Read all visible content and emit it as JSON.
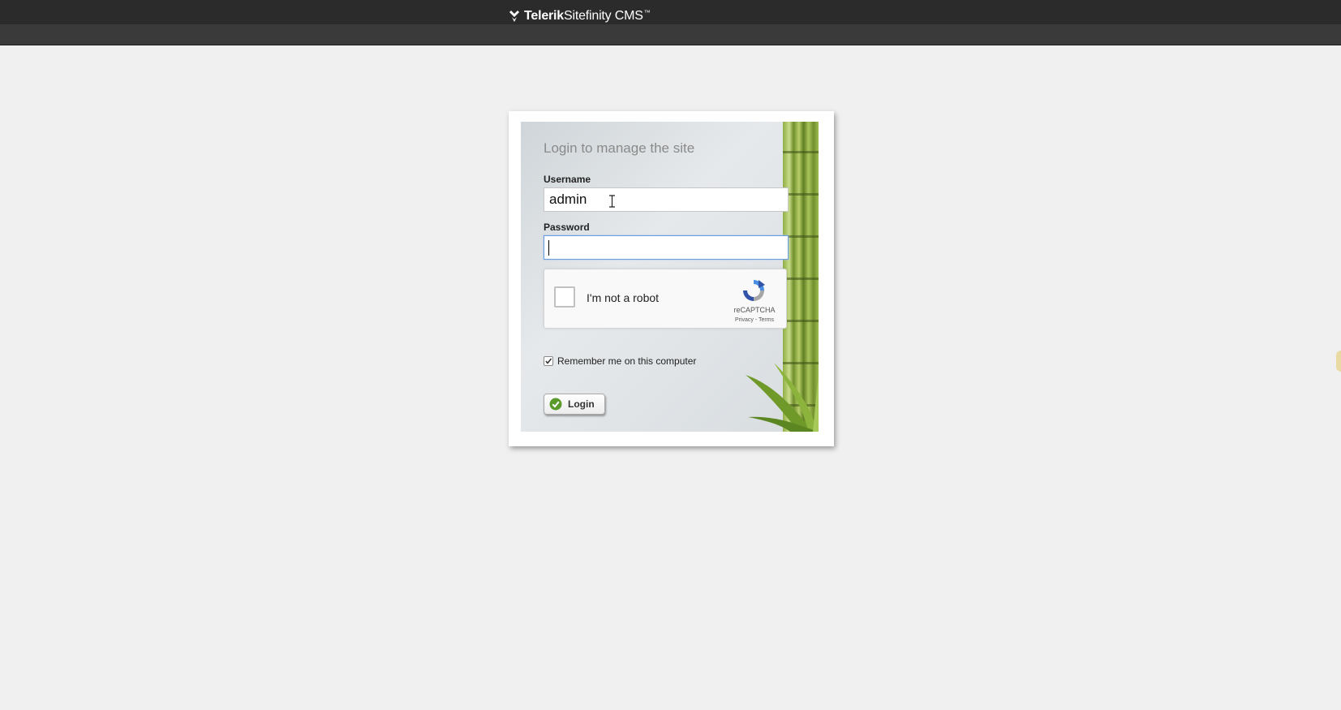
{
  "header": {
    "brand_bold": "Telerik",
    "brand_light": "Sitefinity CMS",
    "brand_tm": "™",
    "logo_icon": "telerik-logo-icon"
  },
  "login": {
    "title": "Login to manage the site",
    "username_label": "Username",
    "username_value": "admin",
    "password_label": "Password",
    "password_value": "",
    "remember_label": "Remember me on this computer",
    "remember_checked": true,
    "login_button_label": "Login",
    "login_icon": "check-circle-icon"
  },
  "captcha": {
    "label": "I'm not a robot",
    "brand": "reCAPTCHA",
    "links": "Privacy - Terms",
    "checked": false
  },
  "colors": {
    "header_bg": "#2b2b2b",
    "page_bg": "#f0f0f0",
    "focus_border": "#6d9be0",
    "login_icon_green": "#5a9a2a"
  }
}
